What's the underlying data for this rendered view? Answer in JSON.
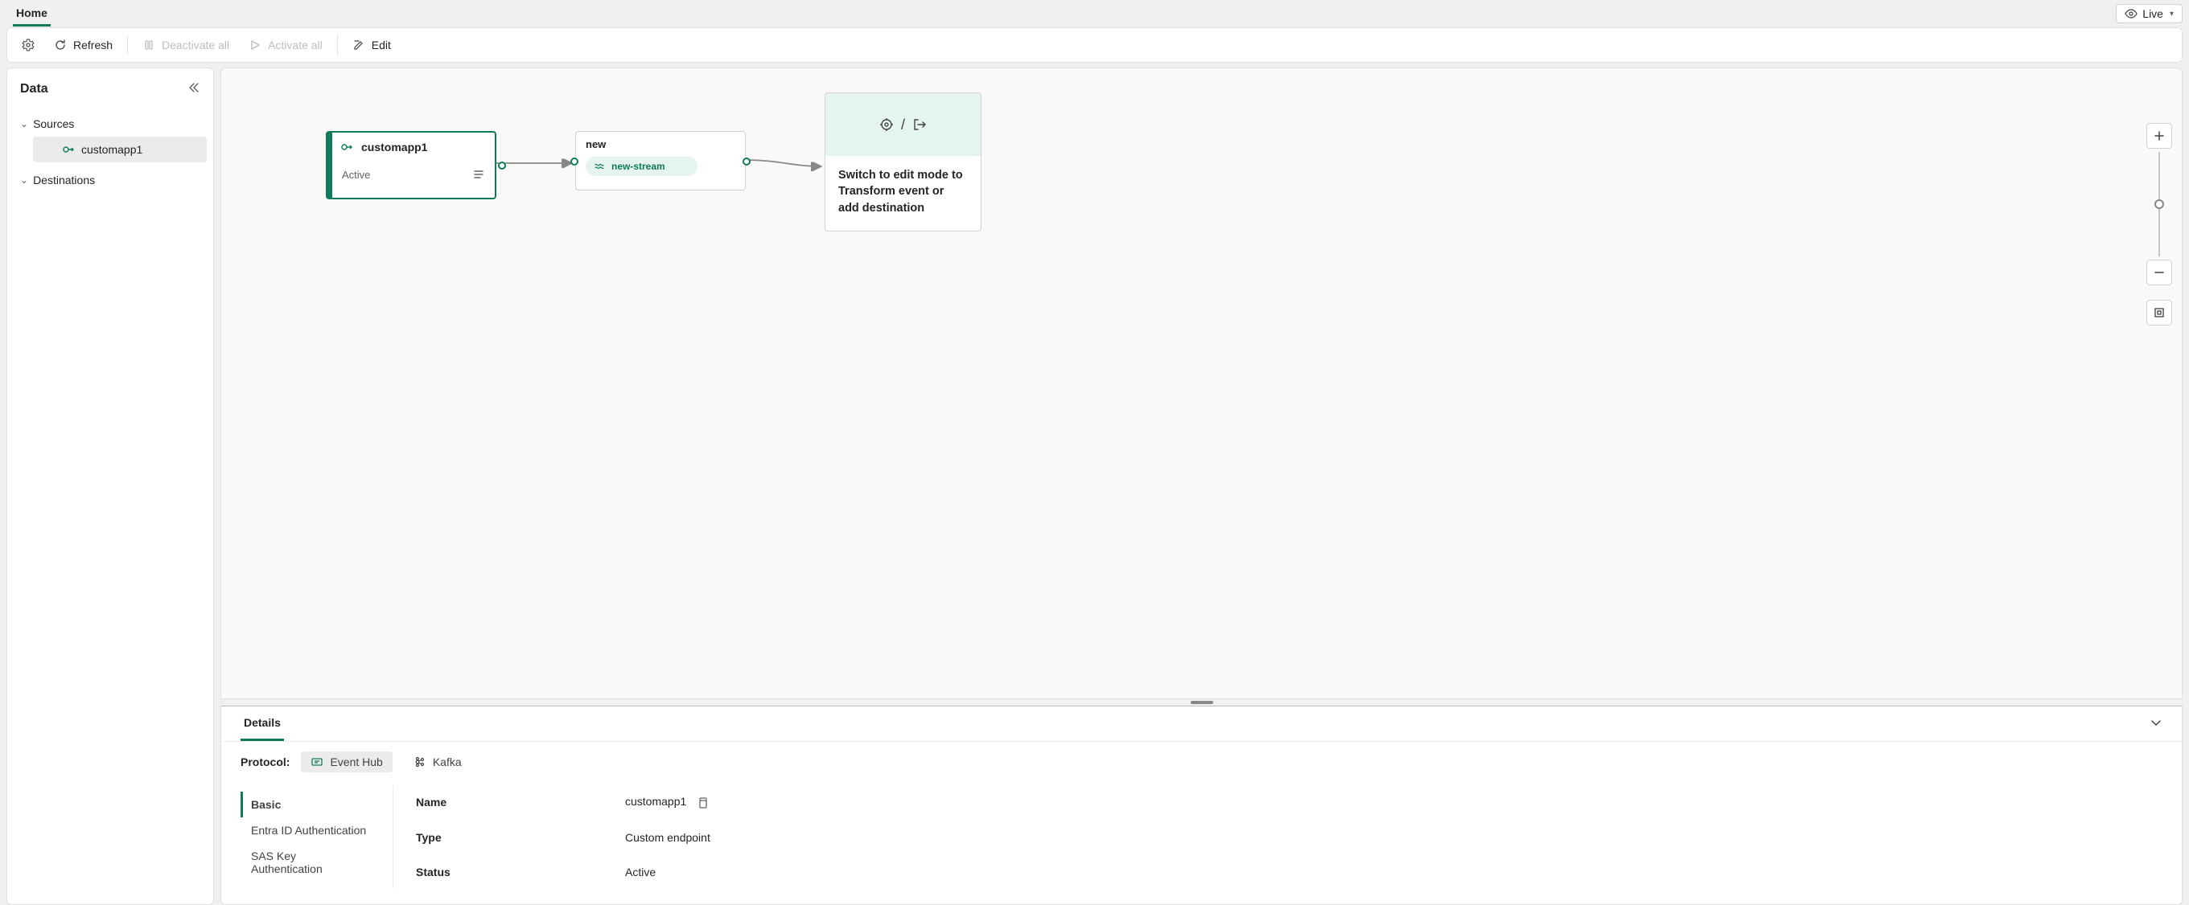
{
  "topbar": {
    "home_tab": "Home",
    "live_label": "Live"
  },
  "toolbar": {
    "refresh": "Refresh",
    "deactivate_all": "Deactivate all",
    "activate_all": "Activate all",
    "edit": "Edit"
  },
  "sidebar": {
    "title": "Data",
    "sources_label": "Sources",
    "destinations_label": "Destinations",
    "sources": [
      {
        "label": "customapp1"
      }
    ]
  },
  "canvas": {
    "source_node": {
      "title": "customapp1",
      "status": "Active"
    },
    "stream_node": {
      "title": "new",
      "pill": "new-stream"
    },
    "dest_node": {
      "separator": "/",
      "hint": "Switch to edit mode to Transform event or add destination"
    },
    "zoom_thumb_pct": 45
  },
  "details": {
    "tab_label": "Details",
    "protocol_label": "Protocol:",
    "protocols": {
      "eventhub": "Event Hub",
      "kafka": "Kafka"
    },
    "nav": {
      "basic": "Basic",
      "entra": "Entra ID Authentication",
      "sas": "SAS Key Authentication"
    },
    "fields": {
      "name_k": "Name",
      "name_v": "customapp1",
      "type_k": "Type",
      "type_v": "Custom endpoint",
      "status_k": "Status",
      "status_v": "Active"
    }
  }
}
